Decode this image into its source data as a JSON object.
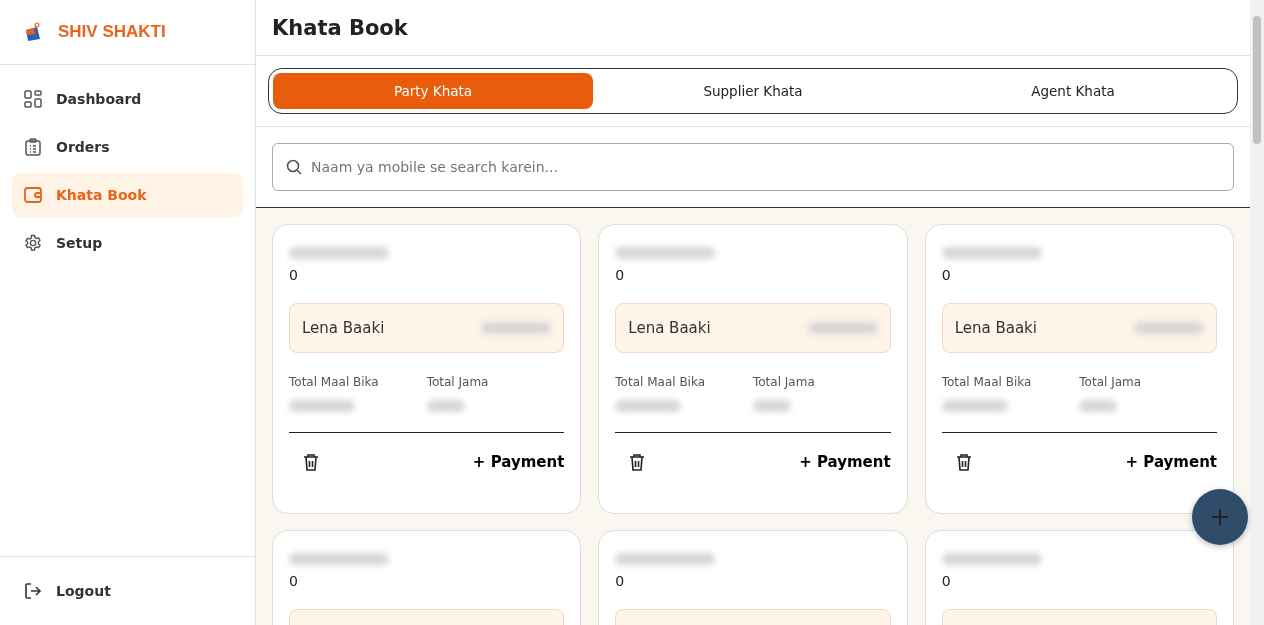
{
  "brand": {
    "name": "SHIV SHAKTI"
  },
  "sidebar": {
    "items": [
      {
        "label": "Dashboard",
        "selected": false
      },
      {
        "label": "Orders",
        "selected": false
      },
      {
        "label": "Khata Book",
        "selected": true
      },
      {
        "label": "Setup",
        "selected": false
      }
    ],
    "logout": "Logout"
  },
  "page_title": "Khata Book",
  "tabs": [
    {
      "label": "Party Khata",
      "selected": true
    },
    {
      "label": "Supplier Khata",
      "selected": false
    },
    {
      "label": "Agent Khata",
      "selected": false
    }
  ],
  "search": {
    "placeholder": "Naam ya mobile se search karein..."
  },
  "cards": [
    {
      "kind": "full",
      "count": "0",
      "balance_label": "Lena Baaki",
      "stat_1_label": "Total Maal Bika",
      "stat_2_label": "Total Jama",
      "action": "+ Payment"
    },
    {
      "kind": "full",
      "count": "0",
      "balance_label": "Lena Baaki",
      "stat_1_label": "Total Maal Bika",
      "stat_2_label": "Total Jama",
      "action": "+ Payment"
    },
    {
      "kind": "full",
      "count": "0",
      "balance_label": "Lena Baaki",
      "stat_1_label": "Total Maal Bika",
      "stat_2_label": "Total Jama",
      "action": "+ Payment"
    },
    {
      "kind": "cut",
      "count": "0"
    },
    {
      "kind": "cut",
      "count": "0"
    },
    {
      "kind": "cut",
      "count": "0"
    }
  ]
}
